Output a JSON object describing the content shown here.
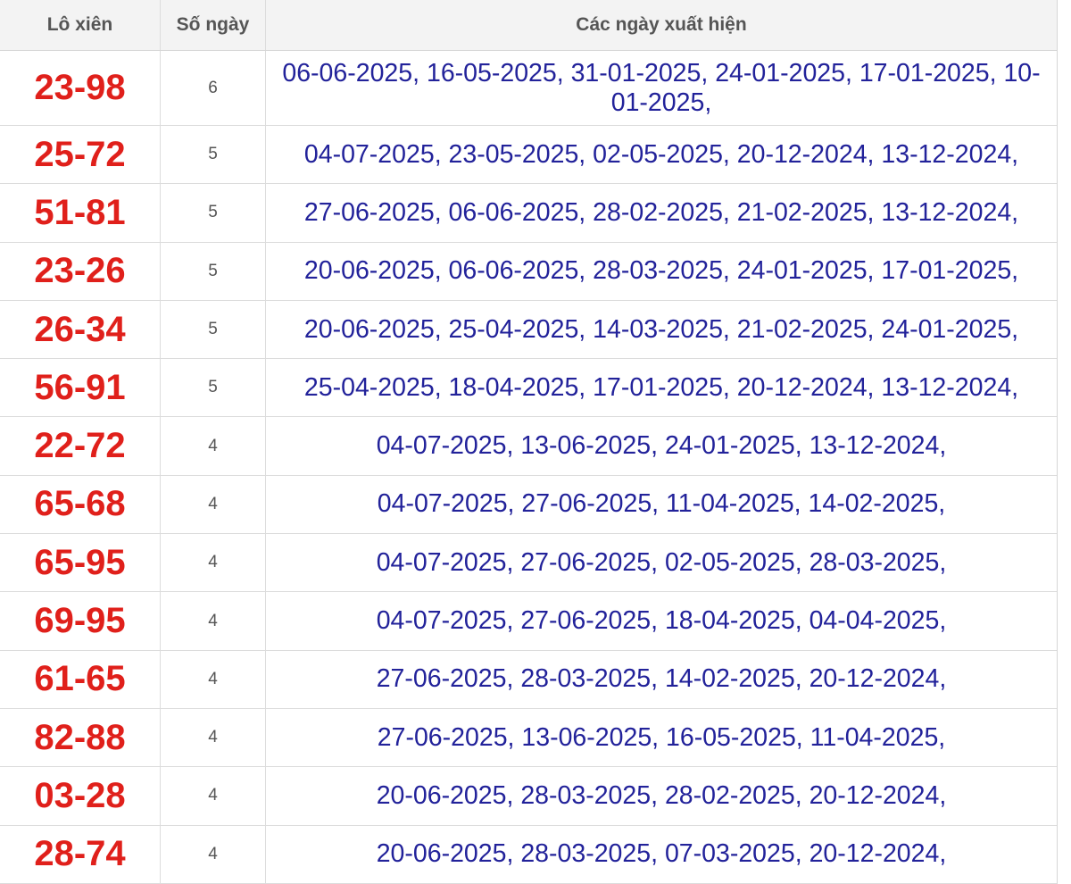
{
  "header": {
    "col_pair": "Lô xiên",
    "col_count": "Số ngày",
    "col_dates": "Các ngày xuất hiện"
  },
  "rows": [
    {
      "pair": "23-98",
      "count": "6",
      "dates": "06-06-2025, 16-05-2025, 31-01-2025, 24-01-2025, 17-01-2025, 10-01-2025,"
    },
    {
      "pair": "25-72",
      "count": "5",
      "dates": "04-07-2025, 23-05-2025, 02-05-2025, 20-12-2024, 13-12-2024,"
    },
    {
      "pair": "51-81",
      "count": "5",
      "dates": "27-06-2025, 06-06-2025, 28-02-2025, 21-02-2025, 13-12-2024,"
    },
    {
      "pair": "23-26",
      "count": "5",
      "dates": "20-06-2025, 06-06-2025, 28-03-2025, 24-01-2025, 17-01-2025,"
    },
    {
      "pair": "26-34",
      "count": "5",
      "dates": "20-06-2025, 25-04-2025, 14-03-2025, 21-02-2025, 24-01-2025,"
    },
    {
      "pair": "56-91",
      "count": "5",
      "dates": "25-04-2025, 18-04-2025, 17-01-2025, 20-12-2024, 13-12-2024,"
    },
    {
      "pair": "22-72",
      "count": "4",
      "dates": "04-07-2025, 13-06-2025, 24-01-2025, 13-12-2024,"
    },
    {
      "pair": "65-68",
      "count": "4",
      "dates": "04-07-2025, 27-06-2025, 11-04-2025, 14-02-2025,"
    },
    {
      "pair": "65-95",
      "count": "4",
      "dates": "04-07-2025, 27-06-2025, 02-05-2025, 28-03-2025,"
    },
    {
      "pair": "69-95",
      "count": "4",
      "dates": "04-07-2025, 27-06-2025, 18-04-2025, 04-04-2025,"
    },
    {
      "pair": "61-65",
      "count": "4",
      "dates": "27-06-2025, 28-03-2025, 14-02-2025, 20-12-2024,"
    },
    {
      "pair": "82-88",
      "count": "4",
      "dates": "27-06-2025, 13-06-2025, 16-05-2025, 11-04-2025,"
    },
    {
      "pair": "03-28",
      "count": "4",
      "dates": "20-06-2025, 28-03-2025, 28-02-2025, 20-12-2024,"
    },
    {
      "pair": "28-74",
      "count": "4",
      "dates": "20-06-2025, 28-03-2025, 07-03-2025, 20-12-2024,"
    }
  ],
  "colors": {
    "pair": "#e0201b",
    "dates": "#22229a",
    "header_bg": "#f3f3f3"
  }
}
